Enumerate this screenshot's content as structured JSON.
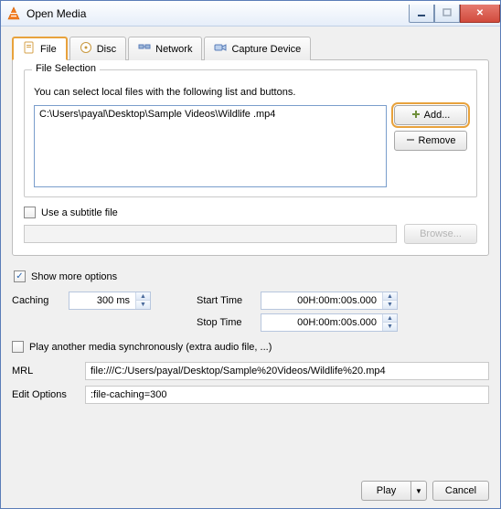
{
  "window": {
    "title": "Open Media"
  },
  "tabs": {
    "file": "File",
    "disc": "Disc",
    "network": "Network",
    "capture": "Capture Device"
  },
  "file_selection": {
    "group_title": "File Selection",
    "hint": "You can select local files with the following list and buttons.",
    "list_item": "C:\\Users\\payal\\Desktop\\Sample Videos\\Wildlife .mp4",
    "add_label": "Add...",
    "remove_label": "Remove"
  },
  "subtitle": {
    "checkbox_label": "Use a subtitle file",
    "browse_label": "Browse...",
    "path": ""
  },
  "more_options": {
    "checkbox_label": "Show more options",
    "caching_label": "Caching",
    "caching_value": "300 ms",
    "start_time_label": "Start Time",
    "start_time_value": "00H:00m:00s.000",
    "stop_time_label": "Stop Time",
    "stop_time_value": "00H:00m:00s.000",
    "play_sync_label": "Play another media synchronously (extra audio file, ...)",
    "mrl_label": "MRL",
    "mrl_value": "file:///C:/Users/payal/Desktop/Sample%20Videos/Wildlife%20.mp4",
    "edit_opts_label": "Edit Options",
    "edit_opts_value": ":file-caching=300"
  },
  "buttons": {
    "play": "Play",
    "cancel": "Cancel"
  }
}
